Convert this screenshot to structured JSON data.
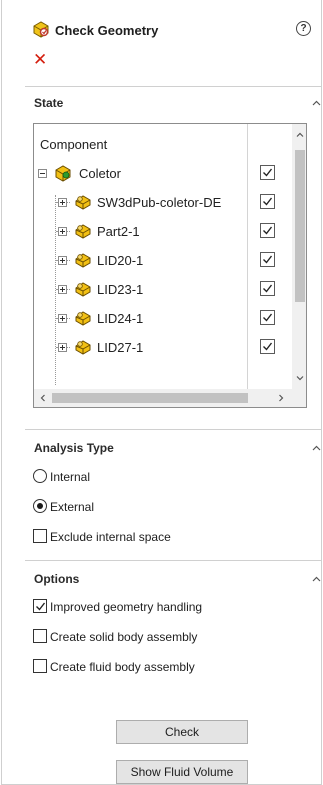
{
  "header": {
    "title": "Check Geometry",
    "help_icon": "help-icon",
    "close_icon": "close-icon",
    "close_color": "#d41e0e"
  },
  "state": {
    "title": "State",
    "column_header": "Component",
    "rows": [
      {
        "label": "Coletor",
        "checked": true,
        "expander": "minus"
      },
      {
        "label": "SW3dPub-coletor-DE",
        "checked": true,
        "expander": "plus"
      },
      {
        "label": "Part2-1",
        "checked": true,
        "expander": "plus"
      },
      {
        "label": "LID20-1",
        "checked": true,
        "expander": "plus"
      },
      {
        "label": "LID23-1",
        "checked": true,
        "expander": "plus"
      },
      {
        "label": "LID24-1",
        "checked": true,
        "expander": "plus"
      },
      {
        "label": "LID27-1",
        "checked": true,
        "expander": "plus"
      }
    ]
  },
  "analysis_type": {
    "title": "Analysis Type",
    "internal_label": "Internal",
    "external_label": "External",
    "selected": "External",
    "exclude_label": "Exclude internal space",
    "exclude_checked": false
  },
  "options": {
    "title": "Options",
    "improved_label": "Improved geometry handling",
    "improved_checked": true,
    "solid_label": "Create solid body assembly",
    "solid_checked": false,
    "fluid_label": "Create fluid body assembly",
    "fluid_checked": false
  },
  "buttons": {
    "check_label": "Check",
    "show_fluid_label": "Show Fluid Volume"
  }
}
